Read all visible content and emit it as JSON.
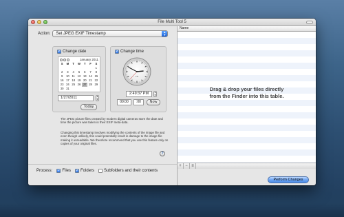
{
  "window": {
    "title": "File Multi Tool 5"
  },
  "action": {
    "label": "Action:",
    "selected": "Set JPEG EXIF Timestamp"
  },
  "date_group": {
    "checkbox_label": "Change date",
    "checked": true,
    "calendar": {
      "month_year": "January 2011",
      "weekdays": [
        "S",
        "M",
        "T",
        "W",
        "T",
        "F",
        "S"
      ],
      "days": [
        "",
        "",
        "",
        "",
        "",
        "",
        "1",
        "2",
        "3",
        "4",
        "5",
        "6",
        "7",
        "8",
        "9",
        "10",
        "11",
        "12",
        "13",
        "14",
        "15",
        "16",
        "17",
        "18",
        "19",
        "20",
        "21",
        "22",
        "23",
        "24",
        "25",
        "26",
        "27",
        "28",
        "29",
        "30",
        "31",
        "",
        "",
        "",
        "",
        ""
      ],
      "selected_day": "27"
    },
    "date_value": "1/27/2011",
    "today_label": "Today"
  },
  "time_group": {
    "checkbox_label": "Change time",
    "checked": true,
    "clock": {
      "hour": 2,
      "minute": 49,
      "second": 37,
      "ampm": "PM"
    },
    "time_value": "2:49:37 PM",
    "offset_value": "00:00",
    "offset_seconds": ":00",
    "now_label": "Now"
  },
  "info": {
    "paragraph1": "The JPEG picture files created by modern digital cameras store the date and time the picture was taken in their EXIF meta-data.",
    "paragraph2": "Changing this timestamp involves modifying the contents of the image file and even though unlikely, this could potentially result in damage to the image file making it unreadable. We therefore recommend that you use this feature only on copies of your original files.",
    "help_label": "?"
  },
  "process": {
    "label": "Process:",
    "options": [
      {
        "label": "Files",
        "checked": true
      },
      {
        "label": "Folders",
        "checked": true
      },
      {
        "label": "Subfolders and their contents",
        "checked": false
      }
    ]
  },
  "table": {
    "column_name": "Name",
    "drop_hint_line1": "Drag & drop your files directly",
    "drop_hint_line2": "from the Finder into this table.",
    "toolbar": [
      "+",
      "−",
      "≡"
    ]
  },
  "perform_button": "Perform Changes"
}
